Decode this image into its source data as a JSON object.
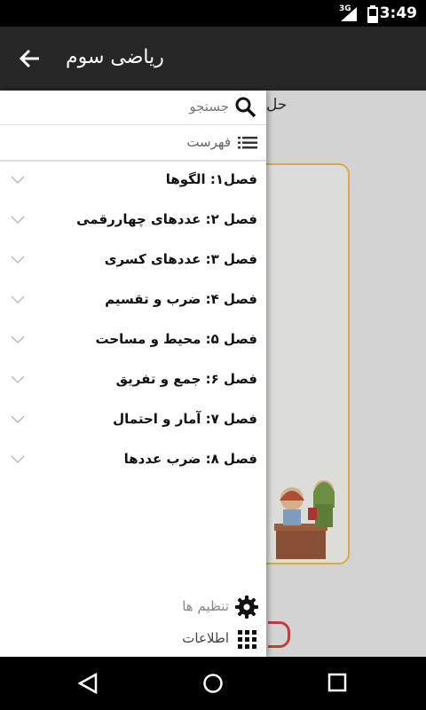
{
  "status_bar": {
    "time": "3:49",
    "network": "3G",
    "icons": [
      "signal-icon",
      "battery-icon"
    ]
  },
  "app_bar": {
    "title": "ریاضی سوم",
    "back_icon": "arrow-back-icon"
  },
  "background": {
    "snippet": "حل"
  },
  "drawer": {
    "search": {
      "label": "جستجو",
      "icon": "search-icon"
    },
    "index": {
      "label": "فهرست",
      "icon": "list-icon"
    },
    "chapters": [
      {
        "label": "فصل۱: الگوها"
      },
      {
        "label": "فصل ۲: عددهای چهاررقمی"
      },
      {
        "label": "فصل ۳: عددهای کسری"
      },
      {
        "label": "فصل ۴: ضرب و تقسیم"
      },
      {
        "label": "فصل ۵: محیط و مساحت"
      },
      {
        "label": "فصل ۶: جمع و تفریق"
      },
      {
        "label": "فصل ۷: آمار و احتمال"
      },
      {
        "label": "فصل ۸: ضرب عددها"
      }
    ],
    "settings": {
      "label": "تنظیم ها",
      "icon": "gear-icon"
    },
    "about": {
      "label": "اطلاعات",
      "icon": "grid-icon"
    }
  },
  "nav_bar": {
    "icons": [
      "back-triangle-icon",
      "home-circle-icon",
      "recents-square-icon"
    ]
  }
}
